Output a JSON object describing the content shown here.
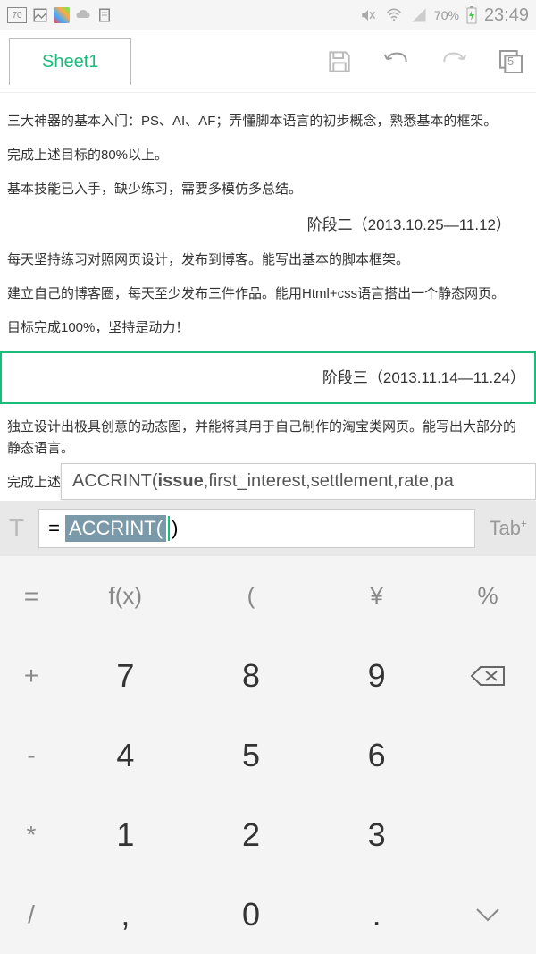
{
  "status": {
    "battery_box": "70",
    "battery_pct": "70%",
    "time": "23:49"
  },
  "toolbar": {
    "tab_name": "Sheet1",
    "page_badge": "5"
  },
  "content": {
    "p1": "三大神器的基本入门：PS、AI、AF；弄懂脚本语言的初步概念，熟悉基本的框架。",
    "p2": "完成上述目标的80%以上。",
    "p3": "基本技能已入手，缺少练习，需要多模仿多总结。",
    "phase2": "阶段二（2013.10.25—11.12）",
    "p4": "每天坚持练习对照网页设计，发布到博客。能写出基本的脚本框架。",
    "p5": "建立自己的博客圈，每天至少发布三件作品。能用Html+css语言搭出一个静态网页。",
    "p6": "目标完成100%，坚持是动力！",
    "phase3": "阶段三（2013.11.14—11.24）",
    "p7": "独立设计出极具创意的动态图，并能将其用于自己制作的淘宝类网页。能写出大部分的静态语言。",
    "p8_truncated": "完成上述目"
  },
  "autocomplete": {
    "prefix": "ACCRINT(",
    "bold_arg": "issue",
    "rest": ",first_interest,settlement,rate,pa"
  },
  "formula": {
    "equals": "=",
    "highlighted": "ACCRINT(",
    "after": ")",
    "tab_label": "Tab"
  },
  "keys": {
    "r1": [
      "=",
      "f(x)",
      "(",
      "¥",
      "%"
    ],
    "side": [
      "+",
      "-",
      "*",
      "/"
    ],
    "nums": [
      [
        "7",
        "8",
        "9"
      ],
      [
        "4",
        "5",
        "6"
      ],
      [
        "1",
        "2",
        "3"
      ],
      [
        ",",
        "0",
        "."
      ]
    ]
  }
}
